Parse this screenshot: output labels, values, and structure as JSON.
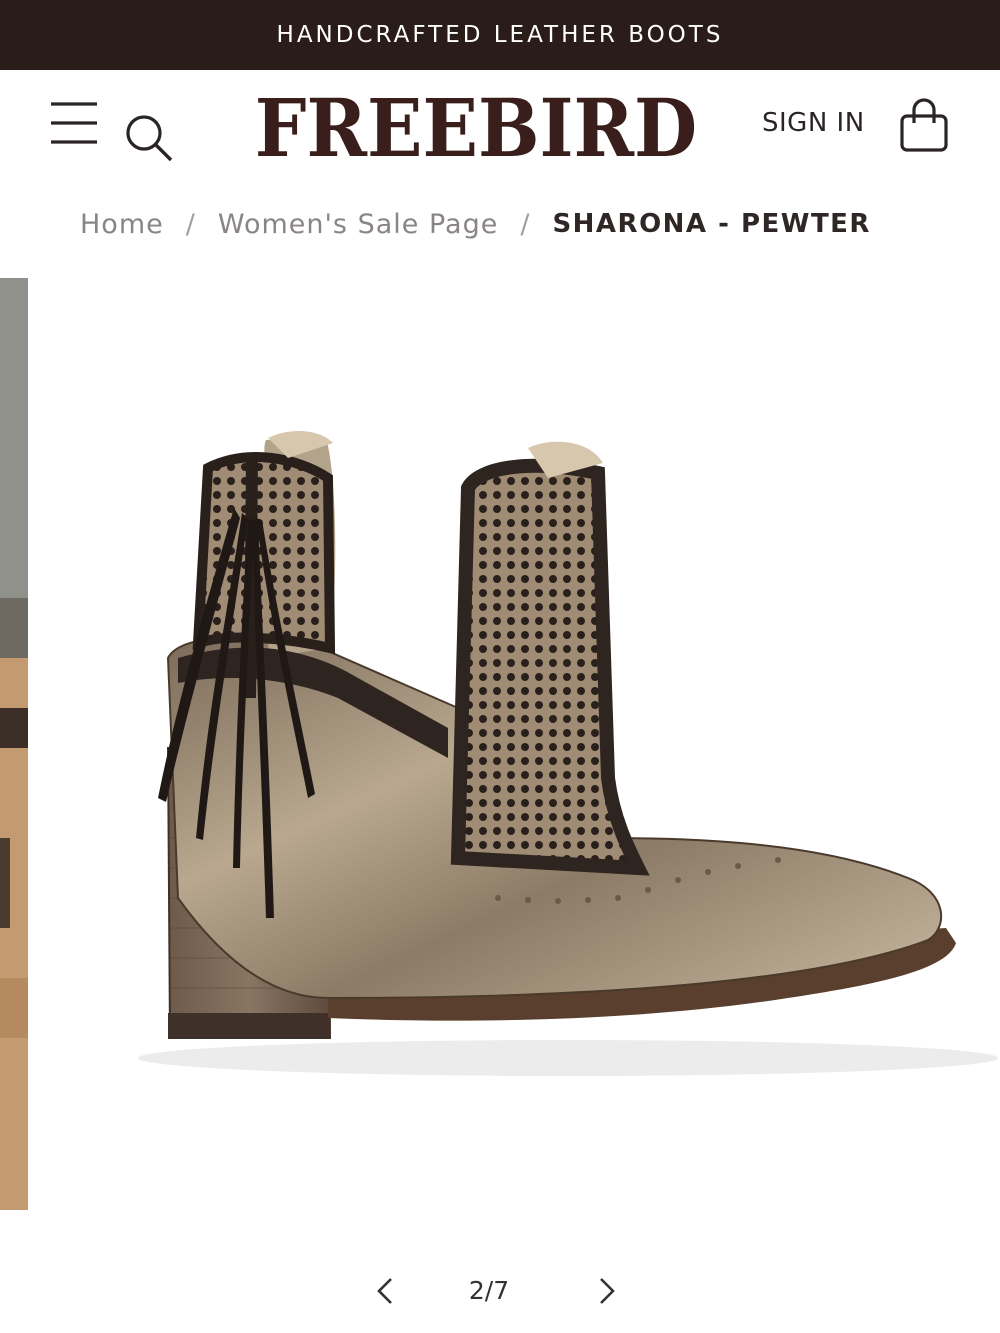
{
  "announcement": {
    "text": "HANDCRAFTED LEATHER BOOTS"
  },
  "header": {
    "logo": "FREEBIRD",
    "signin_label": "SIGN IN",
    "icons": {
      "menu": "hamburger-menu-icon",
      "search": "search-icon",
      "bag": "shopping-bag-icon"
    }
  },
  "breadcrumb": {
    "items": [
      {
        "label": "Home"
      },
      {
        "label": "Women's Sale Page"
      }
    ],
    "separator": "/",
    "current": "SHARONA - PEWTER"
  },
  "gallery": {
    "counter": "2/7",
    "icons": {
      "prev": "chevron-left-icon",
      "next": "chevron-right-icon"
    }
  },
  "colors": {
    "announcement_bg": "#2a1d19",
    "logo": "#3a1e1b",
    "breadcrumb_link": "#8a8585",
    "breadcrumb_current": "#2f2626"
  }
}
